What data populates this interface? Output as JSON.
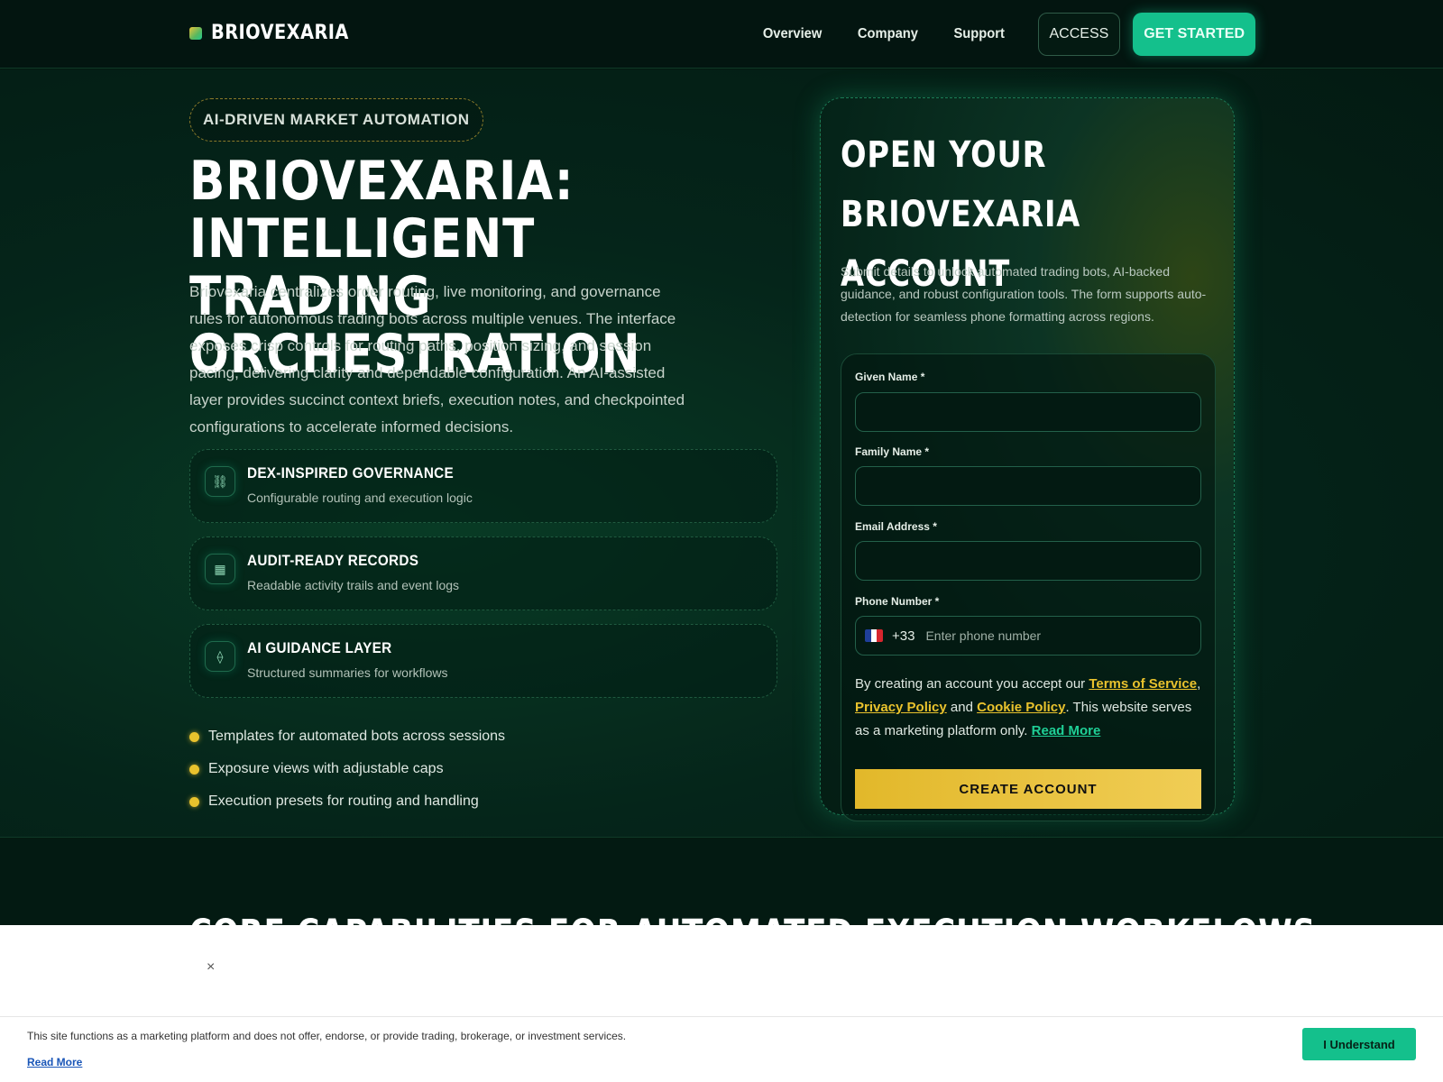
{
  "header": {
    "brand": "BRIOVEXARIA",
    "nav": [
      "Overview",
      "Company",
      "Support"
    ],
    "access_label": "ACCESS",
    "get_started_label": "GET STARTED"
  },
  "hero": {
    "pill": "AI-DRIVEN MARKET AUTOMATION",
    "title_line1": "BRIOVEXARIA: INTELLIGENT",
    "title_line2": "TRADING ORCHESTRATION",
    "description": "Briovexaria centralizes order routing, live monitoring, and governance rules for autonomous trading bots across multiple venues. The interface exposes crisp controls for routing paths, position sizing, and session pacing, delivering clarity and dependable configuration. An AI-assisted layer provides succinct context briefs, execution notes, and checkpointed configurations to accelerate informed decisions.",
    "features": [
      {
        "icon": "link-icon",
        "glyph": "⛓",
        "title": "DEX-INSPIRED GOVERNANCE",
        "subtitle": "Configurable routing and execution logic"
      },
      {
        "icon": "grid-icon",
        "glyph": "▦",
        "title": "AUDIT-READY RECORDS",
        "subtitle": "Readable activity trails and event logs"
      },
      {
        "icon": "diamond-icon",
        "glyph": "⟠",
        "title": "AI GUIDANCE LAYER",
        "subtitle": "Structured summaries for workflows"
      }
    ],
    "bullets": [
      "Templates for automated bots across sessions",
      "Exposure views with adjustable caps",
      "Execution presets for routing and handling"
    ]
  },
  "signup": {
    "title_line1": "OPEN YOUR",
    "title_line2": "BRIOVEXARIA ACCOUNT",
    "description": "Submit details to unlock automated trading bots, AI-backed guidance, and robust configuration tools. The form supports auto-detection for seamless phone formatting across regions.",
    "fields": {
      "given_name": {
        "label": "Given Name *",
        "value": ""
      },
      "family_name": {
        "label": "Family Name *",
        "value": ""
      },
      "email": {
        "label": "Email Address *",
        "value": ""
      },
      "phone": {
        "label": "Phone Number *",
        "dial_code": "+33",
        "placeholder": "Enter phone number"
      }
    },
    "consent": {
      "prefix": "By creating an account you accept our ",
      "terms": "Terms of Service",
      "sep1": ", ",
      "privacy": "Privacy Policy",
      "and": " and ",
      "cookie": "Cookie Policy",
      "suffix": ". This website serves as a marketing platform only. ",
      "read_more": "Read More"
    },
    "submit_label": "CREATE ACCOUNT"
  },
  "next_section": {
    "title": "CORE CAPABILITIES FOR AUTOMATED EXECUTION WORKFLOWS"
  },
  "overlay": {
    "close": "×"
  },
  "cookie_bar": {
    "text": "This site functions as a marketing platform and does not offer, endorse, or provide trading, brokerage, or investment services.",
    "link": "Read More",
    "button": "I Understand"
  },
  "colors": {
    "accent_green": "#14c08c",
    "accent_gold": "#e9c22d",
    "background": "#041a10"
  }
}
